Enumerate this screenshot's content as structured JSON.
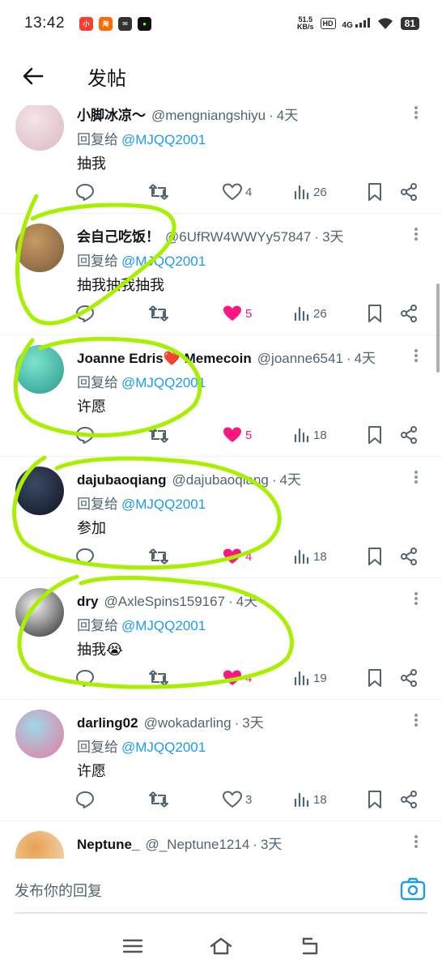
{
  "status_bar": {
    "time": "13:42",
    "net_speed_value": "51.5",
    "net_speed_unit": "KB/s",
    "hd": "HD",
    "signal": "4G",
    "battery": "81",
    "apps": [
      {
        "icon": "video-app-icon",
        "text": "小",
        "color": "#ff3b30"
      },
      {
        "icon": "taobao-app-icon",
        "text": "淘",
        "color": "#ff6a00"
      },
      {
        "icon": "mail-app-icon",
        "text": "✉",
        "color": "#333333"
      },
      {
        "icon": "green-app-icon",
        "text": "●",
        "color": "#111111"
      }
    ]
  },
  "header": {
    "title": "发帖",
    "back_icon": "arrow-left-icon"
  },
  "reply_prefix": "回复给",
  "tweets": [
    {
      "name": "小脚冰凉〜",
      "handle": "@mengniangshiyu",
      "time": "4天",
      "mention": "@MJQQ2001",
      "text": "抽我",
      "likes": "4",
      "liked": false,
      "views": "26",
      "avatar_colors": [
        "#f4e6e8",
        "#d9b9c2"
      ]
    },
    {
      "name": "会自己吃饭！",
      "handle": "@6UfRW4WWYy57847",
      "time": "3天",
      "mention": "@MJQQ2001",
      "text": "抽我抽我抽我",
      "likes": "5",
      "liked": true,
      "views": "26",
      "avatar_colors": [
        "#c89a64",
        "#7a5a3a"
      ]
    },
    {
      "name": "Joanne Edris❤️ Memecoin",
      "handle": "@joanne6541",
      "time": "4天",
      "mention": "@MJQQ2001",
      "text": "许愿",
      "likes": "5",
      "liked": true,
      "views": "18",
      "avatar_colors": [
        "#7de3d0",
        "#2a9a8a"
      ]
    },
    {
      "name": "dajubaoqiang",
      "handle": "@dajubaoqiang",
      "time": "4天",
      "mention": "@MJQQ2001",
      "text": "参加",
      "likes": "4",
      "liked": true,
      "views": "18",
      "avatar_colors": [
        "#3a4a66",
        "#10151f"
      ]
    },
    {
      "name": "dry",
      "handle": "@AxleSpins159167",
      "time": "4天",
      "mention": "@MJQQ2001",
      "text": "抽我😭",
      "likes": "4",
      "liked": true,
      "views": "19",
      "avatar_colors": [
        "#f0f0f0",
        "#2a2a2a"
      ]
    },
    {
      "name": "darling02",
      "handle": "@wokadarling",
      "time": "3天",
      "mention": "@MJQQ2001",
      "text": "许愿",
      "likes": "3",
      "liked": false,
      "views": "18",
      "avatar_colors": [
        "#9fd8e8",
        "#e87aa0"
      ]
    },
    {
      "name": "Neptune_",
      "handle": "@_Neptune1214",
      "time": "3天",
      "mention": "",
      "text": "",
      "likes": "",
      "liked": false,
      "views": "",
      "avatar_colors": [
        "#e8a050",
        "#f5e0c0"
      ]
    }
  ],
  "composer": {
    "placeholder": "发布你的回复",
    "camera_icon": "camera-icon"
  },
  "nav": {
    "menu_icon": "menu-icon",
    "home_icon": "home-icon",
    "back_icon": "back-icon"
  },
  "colors": {
    "accent": "#1d9bf0",
    "like": "#f91880",
    "annotation": "#a8f000"
  }
}
